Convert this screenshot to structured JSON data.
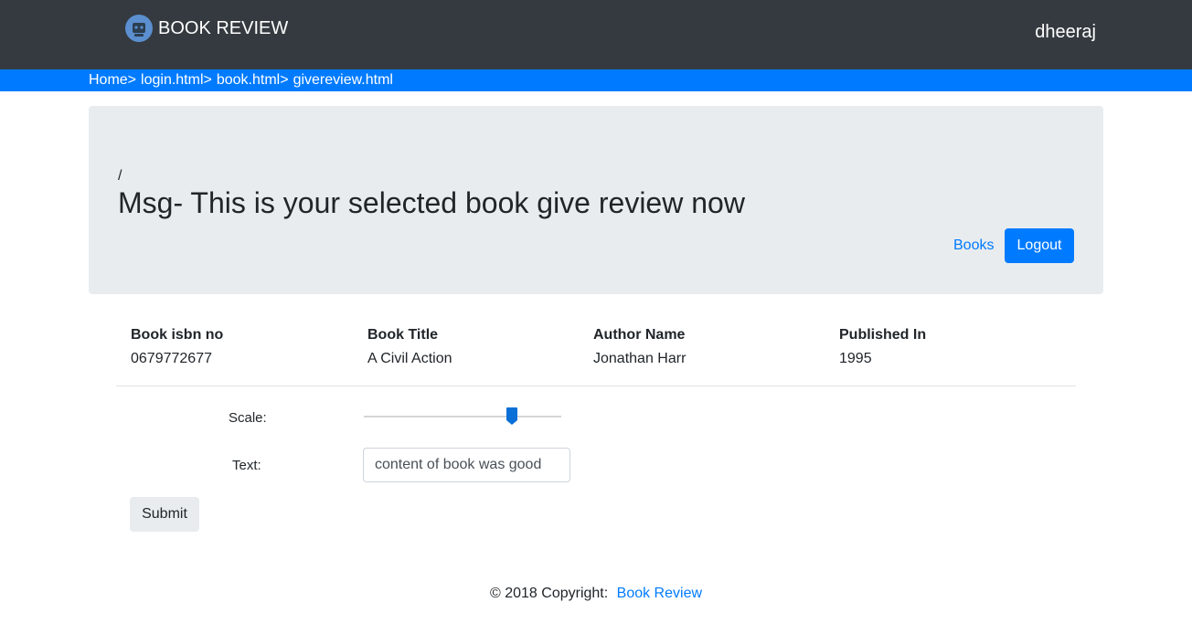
{
  "navbar": {
    "brand": "BOOK REVIEW",
    "brand_icon": "robot-logo-icon",
    "username": "dheeraj",
    "background": "#343a40"
  },
  "breadcrumb": {
    "items": [
      "Home>",
      "login.html>",
      "book.html>",
      "givereview.html"
    ],
    "background": "#007bff"
  },
  "jumbotron": {
    "slash": "/",
    "message": "Msg- This is your selected book give review now",
    "books_link": "Books",
    "logout_button": "Logout"
  },
  "book_table": {
    "headers": [
      "Book isbn no",
      "Book Title",
      "Author Name",
      "Published In"
    ],
    "row": [
      "0679772677",
      "A Civil Action",
      "Jonathan Harr",
      "1995"
    ]
  },
  "review_form": {
    "scale_label": "Scale:",
    "scale_value_fraction": 0.75,
    "text_label": "Text:",
    "text_value": "content of book was good",
    "submit_button": "Submit"
  },
  "footer": {
    "copyright": "© 2018 Copyright:",
    "link": "Book Review"
  },
  "colors": {
    "accent": "#007bff",
    "jumbotron_bg": "#e9ecef"
  }
}
